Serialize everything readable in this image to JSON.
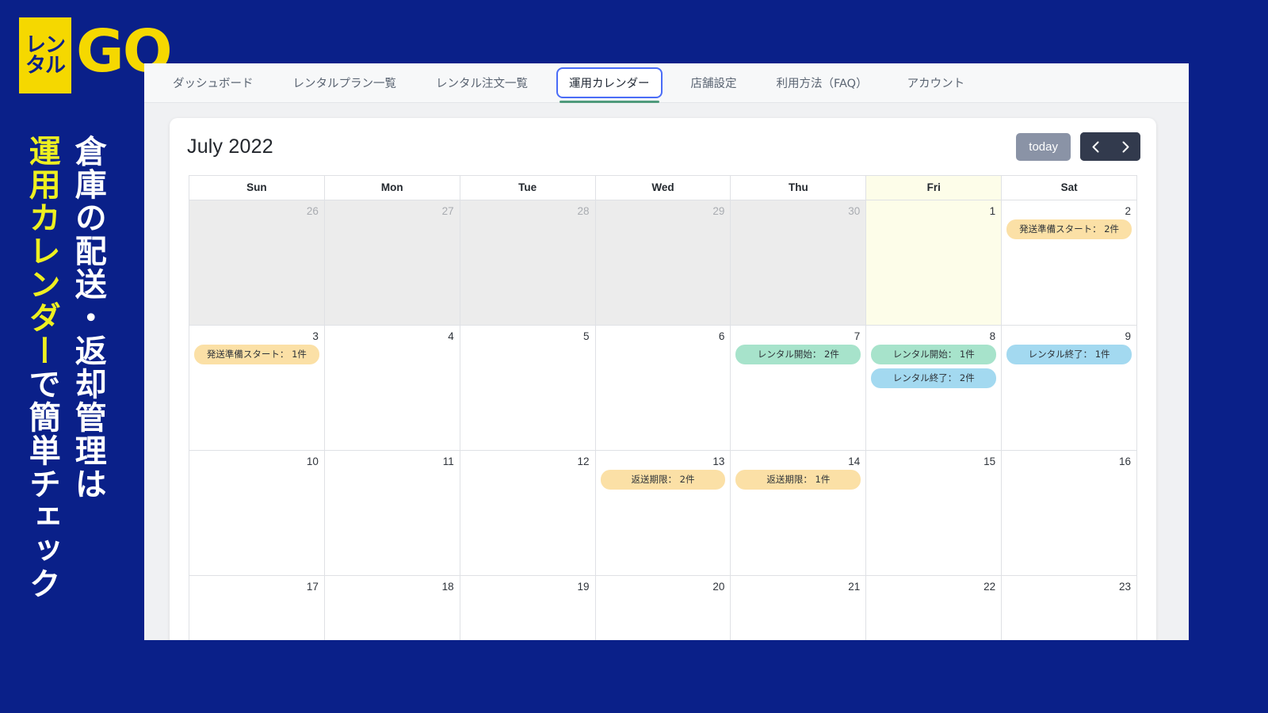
{
  "promo": {
    "logo": {
      "box_line1": "レン",
      "box_line2": "タル",
      "go": "GO"
    },
    "headline_white": "倉庫の配送・返却管理は",
    "headline_accent": "運用カレンダー",
    "headline_accent_tail": "で簡単チェック",
    "colors": {
      "background": "#0a2089",
      "accent": "#eef020",
      "logo_yellow": "#f5d800"
    }
  },
  "navbar": {
    "tabs": [
      {
        "label": "ダッシュボード",
        "active": false
      },
      {
        "label": "レンタルプラン一覧",
        "active": false
      },
      {
        "label": "レンタル注文一覧",
        "active": false
      },
      {
        "label": "運用カレンダー",
        "active": true
      },
      {
        "label": "店舗設定",
        "active": false
      },
      {
        "label": "利用方法（FAQ）",
        "active": false
      },
      {
        "label": "アカウント",
        "active": false
      }
    ],
    "active_tab_border": "#4a6cf7",
    "active_tab_underline": "#4f9a7c"
  },
  "calendar": {
    "title": "July 2022",
    "toolbar": {
      "today_label": "today",
      "prev_label": "‹",
      "next_label": "›"
    },
    "weekday_headers": [
      "Sun",
      "Mon",
      "Tue",
      "Wed",
      "Thu",
      "Fri",
      "Sat"
    ],
    "today_column_index": 5,
    "event_colors": {
      "shipping_prep": "#fbe0a6",
      "rental_start": "#a7e3cb",
      "rental_end": "#a3d9f0",
      "return_due": "#fbe0a6"
    },
    "weeks": [
      [
        {
          "day": "26",
          "other_month": true,
          "today": false,
          "events": []
        },
        {
          "day": "27",
          "other_month": true,
          "today": false,
          "events": []
        },
        {
          "day": "28",
          "other_month": true,
          "today": false,
          "events": []
        },
        {
          "day": "29",
          "other_month": true,
          "today": false,
          "events": []
        },
        {
          "day": "30",
          "other_month": true,
          "today": false,
          "events": []
        },
        {
          "day": "1",
          "other_month": false,
          "today": true,
          "events": []
        },
        {
          "day": "2",
          "other_month": false,
          "today": false,
          "events": [
            {
              "label": "発送準備スタート： 2件",
              "type": "orange"
            }
          ]
        }
      ],
      [
        {
          "day": "3",
          "other_month": false,
          "today": false,
          "events": [
            {
              "label": "発送準備スタート： 1件",
              "type": "orange"
            }
          ]
        },
        {
          "day": "4",
          "other_month": false,
          "today": false,
          "events": []
        },
        {
          "day": "5",
          "other_month": false,
          "today": false,
          "events": []
        },
        {
          "day": "6",
          "other_month": false,
          "today": false,
          "events": []
        },
        {
          "day": "7",
          "other_month": false,
          "today": false,
          "events": [
            {
              "label": "レンタル開始： 2件",
              "type": "green"
            }
          ]
        },
        {
          "day": "8",
          "other_month": false,
          "today": false,
          "events": [
            {
              "label": "レンタル開始： 1件",
              "type": "green"
            },
            {
              "label": "レンタル終了： 2件",
              "type": "blue"
            }
          ]
        },
        {
          "day": "9",
          "other_month": false,
          "today": false,
          "events": [
            {
              "label": "レンタル終了： 1件",
              "type": "blue"
            }
          ]
        }
      ],
      [
        {
          "day": "10",
          "other_month": false,
          "today": false,
          "events": []
        },
        {
          "day": "11",
          "other_month": false,
          "today": false,
          "events": []
        },
        {
          "day": "12",
          "other_month": false,
          "today": false,
          "events": []
        },
        {
          "day": "13",
          "other_month": false,
          "today": false,
          "events": [
            {
              "label": "返送期限： 2件",
              "type": "orange"
            }
          ]
        },
        {
          "day": "14",
          "other_month": false,
          "today": false,
          "events": [
            {
              "label": "返送期限： 1件",
              "type": "orange"
            }
          ]
        },
        {
          "day": "15",
          "other_month": false,
          "today": false,
          "events": []
        },
        {
          "day": "16",
          "other_month": false,
          "today": false,
          "events": []
        }
      ],
      [
        {
          "day": "17",
          "other_month": false,
          "today": false,
          "events": []
        },
        {
          "day": "18",
          "other_month": false,
          "today": false,
          "events": []
        },
        {
          "day": "19",
          "other_month": false,
          "today": false,
          "events": []
        },
        {
          "day": "20",
          "other_month": false,
          "today": false,
          "events": []
        },
        {
          "day": "21",
          "other_month": false,
          "today": false,
          "events": []
        },
        {
          "day": "22",
          "other_month": false,
          "today": false,
          "events": []
        },
        {
          "day": "23",
          "other_month": false,
          "today": false,
          "events": []
        }
      ]
    ]
  }
}
